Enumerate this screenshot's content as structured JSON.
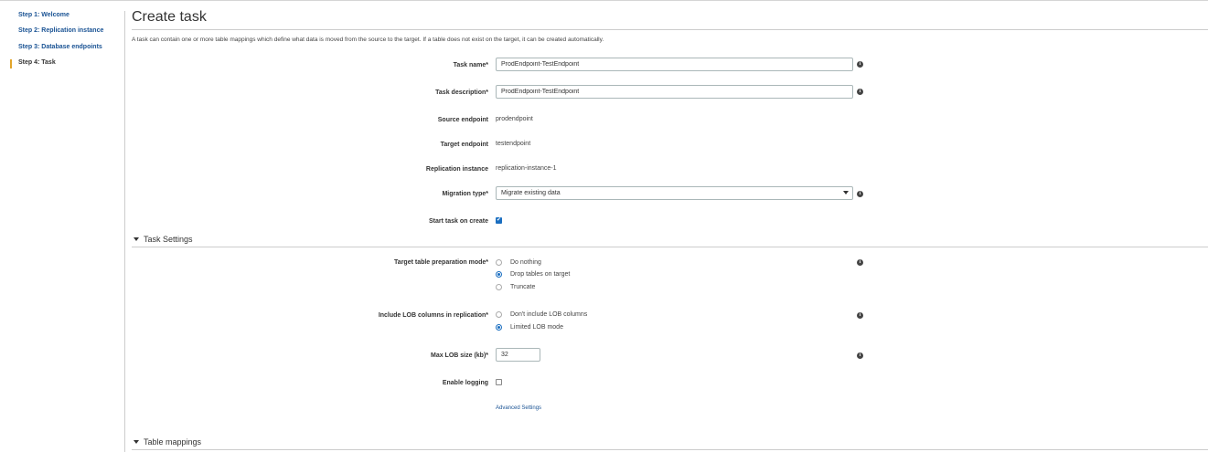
{
  "sidebar": {
    "steps": [
      {
        "label": "Step 1: Welcome"
      },
      {
        "label": "Step 2: Replication instance"
      },
      {
        "label": "Step 3: Database endpoints"
      },
      {
        "label": "Step 4: Task"
      }
    ],
    "active_step": 4
  },
  "page": {
    "title": "Create task",
    "intro": "A task can contain one or more table mappings which define what data is moved from the source to the target. If a table does not exist on the target, it can be created automatically."
  },
  "form": {
    "task_name": {
      "label": "Task name*",
      "value": "ProdEndpoint-TestEndpoint"
    },
    "task_description": {
      "label": "Task description*",
      "value": "ProdEndpoint-TestEndpoint"
    },
    "source_endpoint": {
      "label": "Source endpoint",
      "value": "prodendpoint"
    },
    "target_endpoint": {
      "label": "Target endpoint",
      "value": "testendpoint"
    },
    "replication_instance": {
      "label": "Replication instance",
      "value": "replication-instance-1"
    },
    "migration_type": {
      "label": "Migration type*",
      "value": "Migrate existing data"
    },
    "start_task": {
      "label": "Start task on create",
      "checked": true
    },
    "info_glyph": "i"
  },
  "task_settings": {
    "title": "Task Settings",
    "prep_mode": {
      "label": "Target table preparation mode*",
      "options": [
        {
          "label": "Do nothing",
          "selected": false
        },
        {
          "label": "Drop tables on target",
          "selected": true
        },
        {
          "label": "Truncate",
          "selected": false
        }
      ]
    },
    "lob": {
      "label": "Include LOB columns in replication*",
      "options": [
        {
          "label": "Don't include LOB columns",
          "selected": false
        },
        {
          "label": "Limited LOB mode",
          "selected": true
        }
      ]
    },
    "max_lob": {
      "label": "Max LOB size (kb)*",
      "value": "32"
    },
    "logging": {
      "label": "Enable logging",
      "checked": false
    },
    "advanced_link": "Advanced Settings"
  },
  "table_mappings": {
    "title": "Table mappings"
  },
  "colors": {
    "link": "#1a5394",
    "accent_bar": "#e2a52b",
    "radio_selected": "#1a6ec0"
  }
}
